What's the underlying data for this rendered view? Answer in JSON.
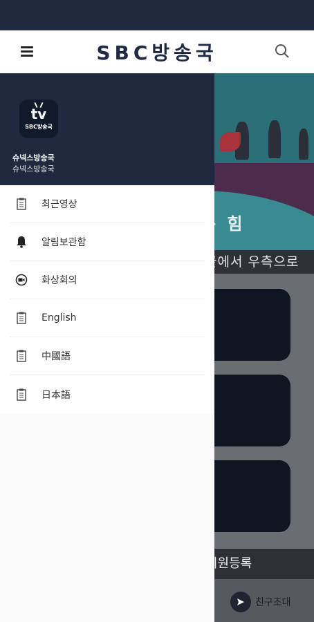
{
  "header": {
    "title": "SBC방송국",
    "menu_icon": "hamburger-icon",
    "search_icon": "search-icon"
  },
  "drawer": {
    "logo_label": "tv",
    "logo_text": "SBC방송국",
    "user_name": "슈넥스방송국",
    "user_sub": "슈넥스방송국",
    "items": [
      {
        "label": "최근영상",
        "icon": "document-icon"
      },
      {
        "label": "알림보관함",
        "icon": "bell-icon"
      },
      {
        "label": "화상회의",
        "icon": "video-call-icon"
      },
      {
        "label": "English",
        "icon": "document-icon"
      },
      {
        "label": "中國語",
        "icon": "document-icon"
      },
      {
        "label": "日本語",
        "icon": "document-icon"
      }
    ]
  },
  "background": {
    "banner_text": "는 힘",
    "marquee_text": "끝에서 우측으로",
    "signup_label": "회원등록",
    "invite_label": "친구초대"
  },
  "colors": {
    "primary": "#1f2940",
    "overlay": "#6a6d72"
  }
}
